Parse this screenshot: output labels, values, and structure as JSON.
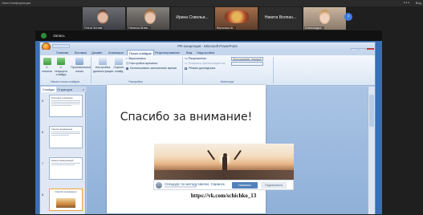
{
  "conference": {
    "title": "Окно Конференции",
    "view_label": "Вид",
    "participants": [
      {
        "name": "Ольга Зотова"
      },
      {
        "name": "Наталья Шлик..."
      },
      {
        "name": "Ирина Совольи...",
        "caption": "Вероника Ш..."
      },
      {
        "name": "Вероника Ш..."
      },
      {
        "name": "Никита Волпан...",
        "caption": "Александра..."
      },
      {
        "name": "Александра..."
      }
    ],
    "next_arrow": "›"
  },
  "taskbar": {
    "app_label": "Запись"
  },
  "ppt": {
    "window_title": "PR-концепция - Microsoft PowerPoint",
    "window_buttons": [
      "–",
      "□",
      "×"
    ],
    "tabs": [
      "Главная",
      "Вставка",
      "Дизайн",
      "Анимация",
      "Показ слайдов",
      "Рецензирование",
      "Вид",
      "Надстройки"
    ],
    "active_tab": "Показ слайдов",
    "ribbon": {
      "btn_from_start": "С начала",
      "btn_from_current": "С текущего слайда",
      "btn_custom": "Произвольный показ",
      "btn_setup": "Настройка демонстрации",
      "btn_hide": "Скрыть слайд",
      "opt_record": "Звукозапись",
      "opt_timings": "Настройка времени",
      "opt_use_timings": "Использовать записанное время",
      "opt_resolution": "Разрешение:",
      "opt_resolution_value": "Использовать текущее",
      "opt_show_on": "Показать презентацию на:",
      "opt_presenter": "Режим докладчика",
      "group_start": "Начать показ слайдов",
      "group_setup": "Настройка",
      "group_monitors": "Мониторы"
    },
    "pane": {
      "tab_slides": "Слайды",
      "tab_outline": "Структура",
      "close": "×",
      "thumbs": [
        {
          "num": "5",
          "title": "Ключевые сообщения",
          "selected": false
        },
        {
          "num": "6",
          "title": "Тактика продвижения",
          "selected": false
        },
        {
          "num": "7",
          "title": "Каналы коммуникаций",
          "selected": false
        },
        {
          "num": "8",
          "title": "Спасибо за внимание!",
          "selected": true
        }
      ]
    },
    "slide": {
      "title": "Спасибо за внимание!",
      "vk_name": "Спецкурс по методу Шичко. Саранск",
      "vk_btn_primary": "Написать",
      "vk_btn_secondary": "Подписаться",
      "link": "https://vk.com/schichko_13"
    }
  },
  "colors": {
    "accent": "#3f7be0",
    "ribbon_bg": "#dbe7f5",
    "vk_blue": "#5181b8"
  }
}
